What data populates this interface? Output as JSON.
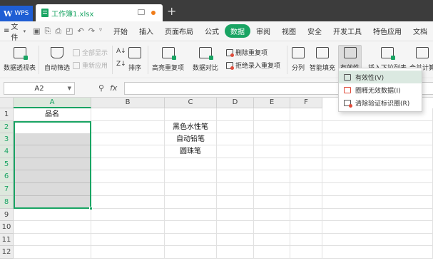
{
  "titlebar": {
    "app_label": "WPS",
    "document_tab": "工作簿1.xlsx",
    "add_tab": "+"
  },
  "menubar": {
    "file_menu": "文件",
    "tabs": [
      "开始",
      "插入",
      "页面布局",
      "公式",
      "数据",
      "审阅",
      "视图",
      "安全",
      "开发工具",
      "特色应用",
      "文档"
    ],
    "active_tab": "数据"
  },
  "ribbon": {
    "pivot_table": "数据透视表",
    "auto_filter": "自动筛选",
    "show_all": "全部显示",
    "reapply": "重新应用",
    "sort": "排序",
    "highlight_duplicates": "高亮重复项",
    "data_compare": "数据对比",
    "delete_duplicates": "删除重复项",
    "reject_duplicates": "拒绝录入重复项",
    "split_columns": "分列",
    "smart_fill": "智能填充",
    "validation": "有效性",
    "insert_dropdown": "插入下拉列表",
    "consolidate": "合并计算"
  },
  "formula_bar": {
    "name_box": "A2",
    "fx_label": "fx",
    "formula_value": ""
  },
  "grid": {
    "columns": [
      "A",
      "B",
      "C",
      "D",
      "E",
      "F"
    ],
    "rows": [
      "1",
      "2",
      "3",
      "4",
      "5",
      "6",
      "7",
      "8",
      "9",
      "10",
      "11",
      "12"
    ],
    "cells": {
      "A1": "品名",
      "C2": "黑色水性笔",
      "C3": "自动铅笔",
      "C4": "圆珠笔"
    }
  },
  "validation_menu": {
    "items": [
      "有效性(V)",
      "圈释无效数据(I)",
      "清除验证标识圈(R)"
    ]
  },
  "colors": {
    "accent": "#19a463",
    "titlebar": "#3c3c3c",
    "wps_blue": "#1f5ed4"
  }
}
